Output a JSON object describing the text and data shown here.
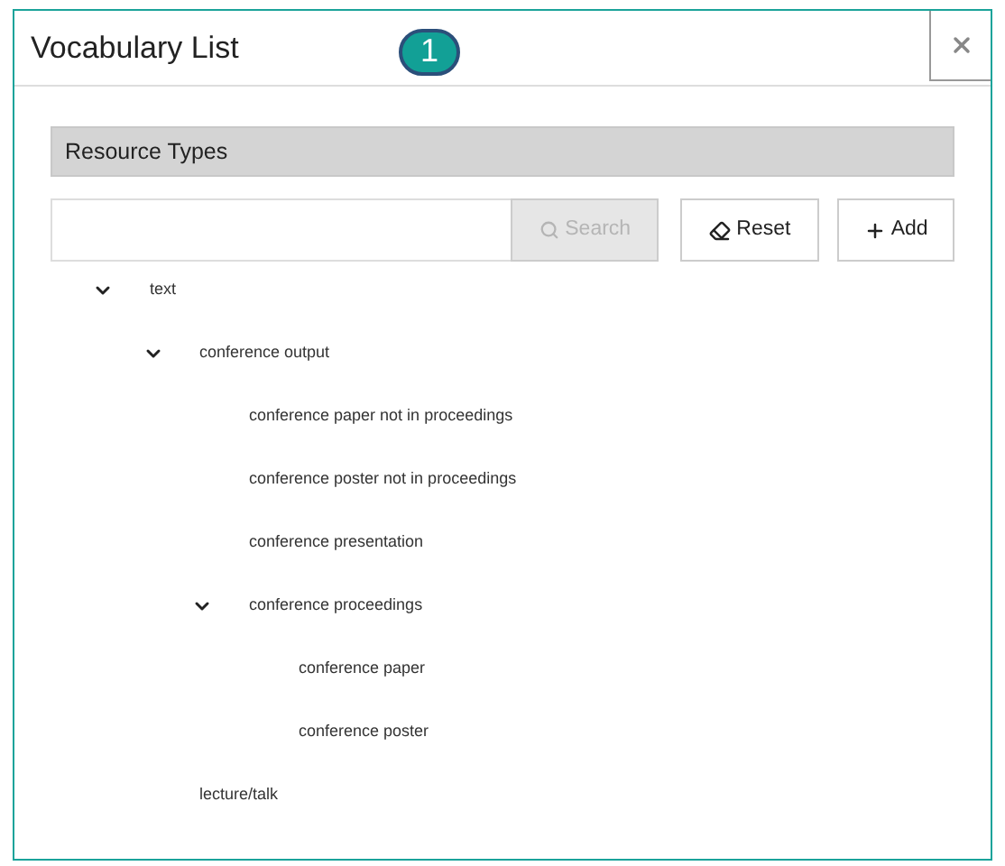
{
  "window": {
    "title": "Vocabulary List",
    "badge": "1"
  },
  "section": {
    "title": "Resource Types"
  },
  "search": {
    "button": "Search",
    "disabled": true
  },
  "buttons": [
    {
      "kind": "reset",
      "label": "Reset"
    },
    {
      "kind": "add",
      "label": "Add"
    }
  ],
  "tree": [
    {
      "label": "text",
      "expanded": true,
      "children": [
        {
          "label": "conference output",
          "expanded": true,
          "children": [
            {
              "label": "conference paper not in proceedings"
            },
            {
              "label": "conference poster not in proceedings"
            },
            {
              "label": "conference presentation"
            },
            {
              "label": "conference proceedings",
              "expanded": true,
              "children": [
                {
                  "label": "conference paper"
                },
                {
                  "label": "conference poster"
                }
              ]
            }
          ]
        },
        {
          "label": "lecture/talk"
        }
      ]
    }
  ]
}
